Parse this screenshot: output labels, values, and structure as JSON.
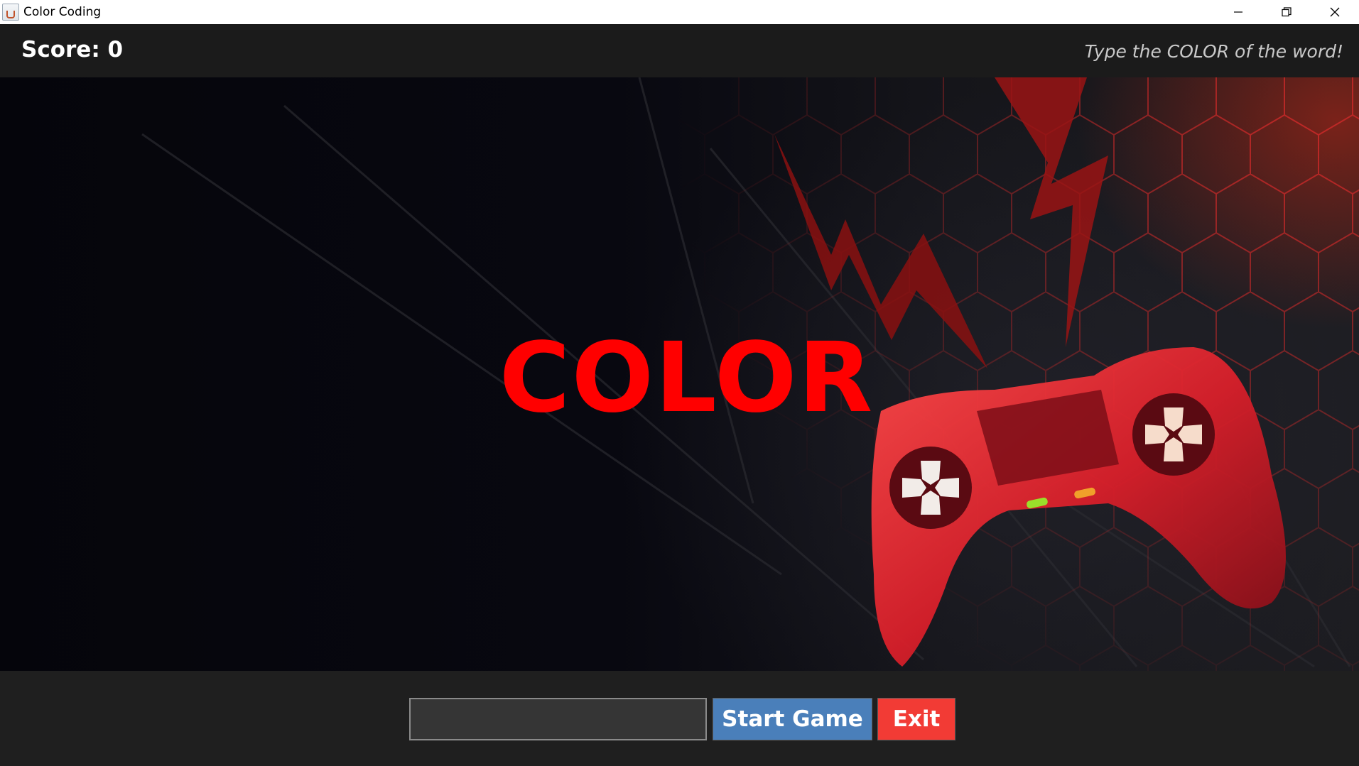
{
  "window": {
    "title": "Color Coding",
    "controls": [
      "minimize-icon",
      "restore-icon",
      "close-icon"
    ]
  },
  "header": {
    "score_text": "Score: 0",
    "instruction": "Type the COLOR of the word!"
  },
  "game": {
    "word": "COLOR",
    "word_color": "#ff0000",
    "background": "dark gaming wallpaper with red hexagon grid and red game controller"
  },
  "controls": {
    "answer_value": "",
    "start_label": "Start Game",
    "exit_label": "Exit",
    "start_color": "#4a7fba",
    "exit_color": "#f23b35"
  }
}
